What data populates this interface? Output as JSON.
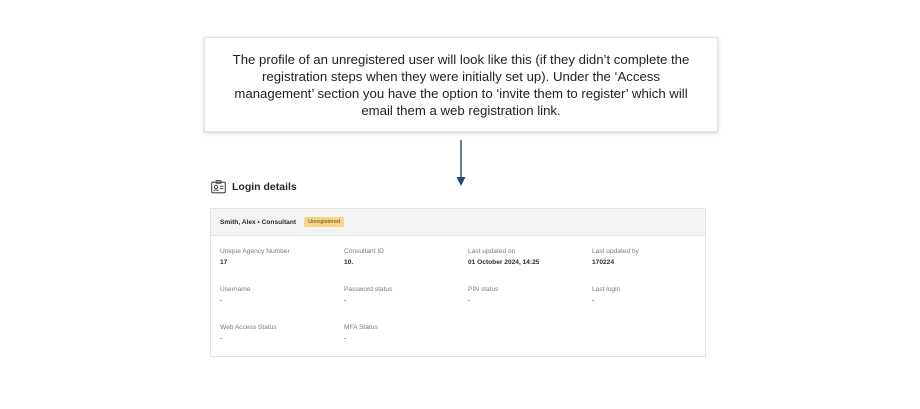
{
  "callout": {
    "text": "The profile of an unregistered user will look like this (if they didn’t complete the registration steps when they were initially set up). Under the ‘Access management’ section you have the option to ‘invite them to register’ which will email them a web registration link."
  },
  "section": {
    "title": "Login details",
    "icon": "id-card-icon"
  },
  "user": {
    "name": "Smith, Alex • Consultant",
    "status_badge": "Unregistered"
  },
  "fields": {
    "agency_number": {
      "label": "Unique Agency Number",
      "value": "17"
    },
    "consultant_id": {
      "label": "Consultant ID",
      "value": "10."
    },
    "last_updated_on": {
      "label": "Last updated on",
      "value": "01 October 2024, 14:25"
    },
    "last_updated_by": {
      "label": "Last updated by",
      "value": "170224"
    },
    "username": {
      "label": "Username",
      "value": "-"
    },
    "password_status": {
      "label": "Password status",
      "value": "-"
    },
    "pin_status": {
      "label": "PIN status",
      "value": "-"
    },
    "last_login": {
      "label": "Last login",
      "value": "-"
    },
    "web_access_status": {
      "label": "Web Access Status",
      "value": "-"
    },
    "mfa_status": {
      "label": "MFA Status",
      "value": "-"
    }
  },
  "colors": {
    "arrow": "#1f4e6e",
    "badge_bg": "#f6d48a"
  }
}
